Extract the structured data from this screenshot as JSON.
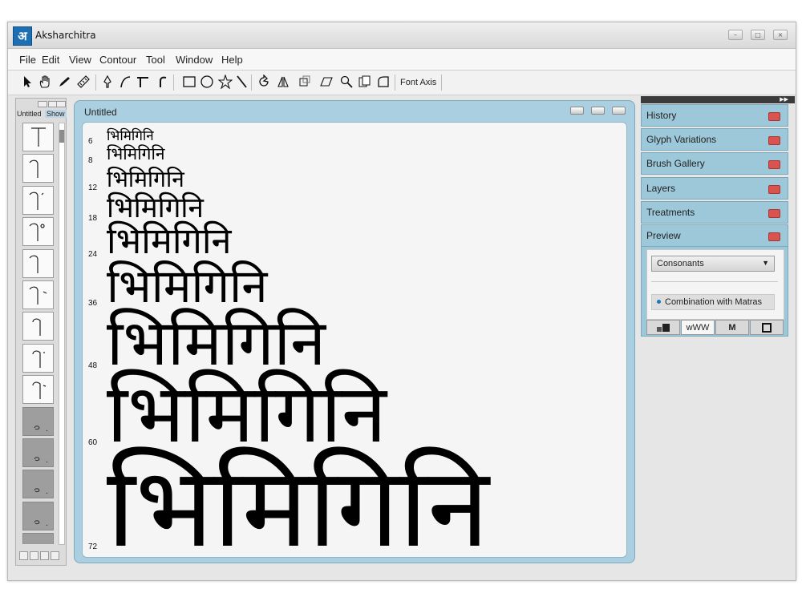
{
  "app": {
    "title": "Aksharchitra",
    "logo_glyph": "अ"
  },
  "window_controls": [
    "minimize-icon",
    "maximize-icon",
    "close-icon"
  ],
  "menu": [
    "File",
    "Edit",
    "View",
    "Contour",
    "Tool",
    "Window",
    "Help"
  ],
  "toolbar": {
    "tools": [
      "pointer-icon",
      "hand-icon",
      "pen-icon",
      "ruler-icon",
      "nib-icon",
      "curve-icon",
      "t-stroke-icon",
      "hook-stroke-icon",
      "rectangle-icon",
      "ellipse-icon",
      "star-icon",
      "line-icon",
      "rotate-icon",
      "mirror-icon",
      "align-icon",
      "skew-icon",
      "zoom-icon",
      "copy-icon",
      "corner-icon"
    ],
    "font_axis_label": "Font Axis"
  },
  "left_panel": {
    "tabs": {
      "untitled": "Untitled",
      "show": "Show"
    },
    "glyph_count": 14
  },
  "document": {
    "title": "Untitled",
    "sample_text": "भिमिगिनि",
    "sizes": [
      "6",
      "8",
      "12",
      "18",
      "24",
      "36",
      "48",
      "60",
      "72"
    ]
  },
  "right_panels": {
    "items": [
      {
        "label": "History"
      },
      {
        "label": "Glyph Variations"
      },
      {
        "label": "Brush Gallery"
      },
      {
        "label": "Layers"
      },
      {
        "label": "Treatments"
      },
      {
        "label": "Preview"
      }
    ],
    "preview": {
      "select_value": "Consonants",
      "combination_label": "Combination with Matras",
      "tabs": [
        "blocks-icon",
        "wWW",
        "M",
        "square-icon"
      ]
    }
  },
  "colors": {
    "panel_blue": "#9cc8da",
    "close_red": "#d9534f",
    "accent": "#1c6fb3"
  }
}
